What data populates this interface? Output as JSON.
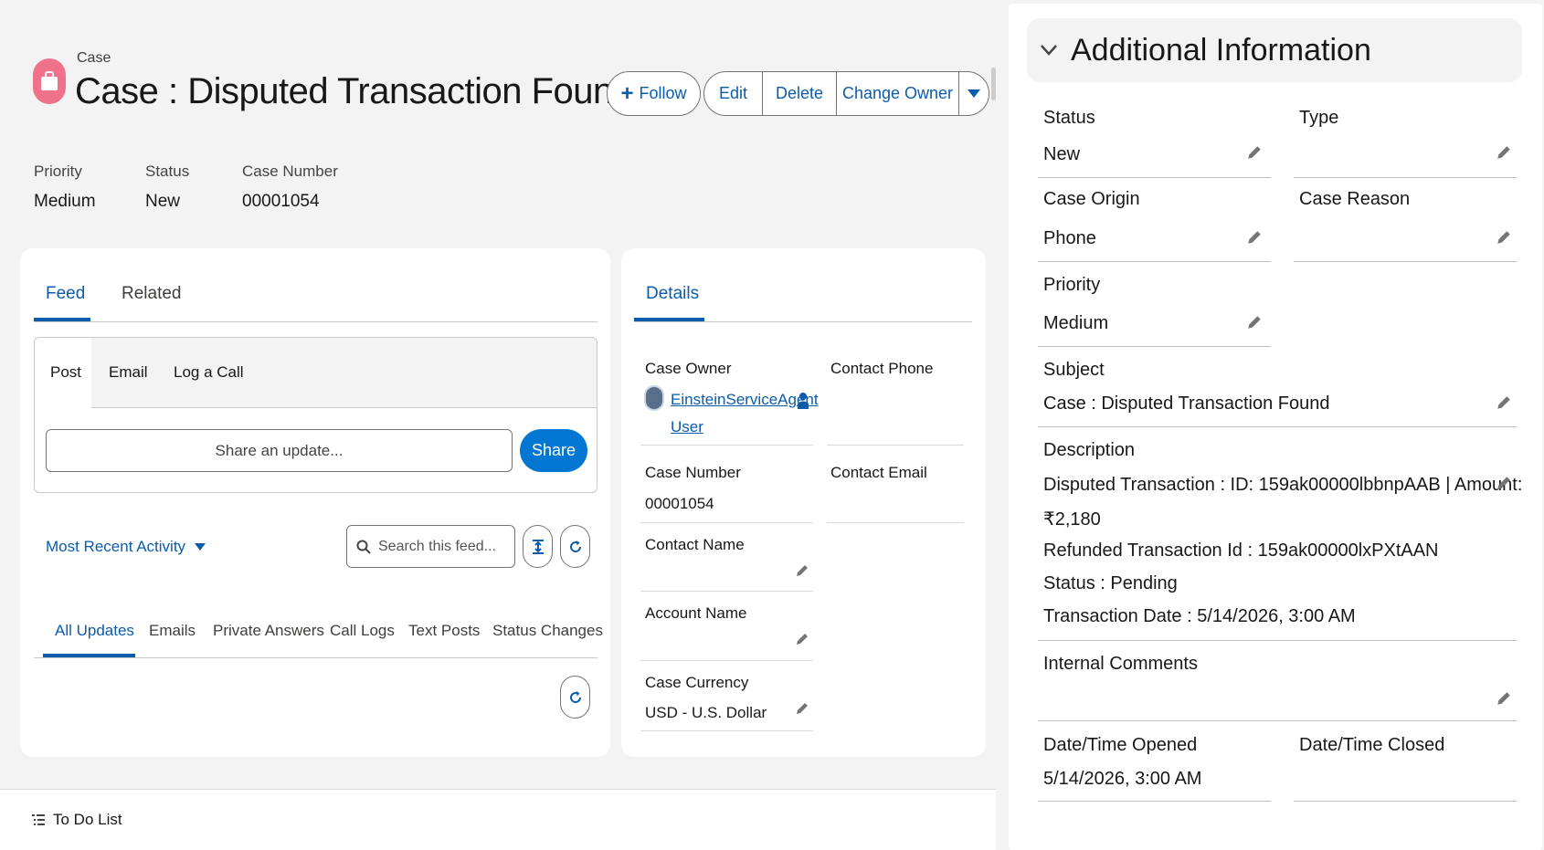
{
  "header": {
    "object_label": "Case",
    "title": "Case : Disputed Transaction Found",
    "buttons": {
      "follow": "Follow",
      "edit": "Edit",
      "delete": "Delete",
      "change_owner": "Change Owner"
    }
  },
  "highlights": [
    {
      "label": "Priority",
      "value": "Medium"
    },
    {
      "label": "Status",
      "value": "New"
    },
    {
      "label": "Case Number",
      "value": "00001054"
    }
  ],
  "feed_card": {
    "tabs": [
      "Feed",
      "Related"
    ],
    "publisher_tabs": [
      "Post",
      "Email",
      "Log a Call"
    ],
    "share_placeholder": "Share an update...",
    "share_button": "Share",
    "sort_label": "Most Recent Activity",
    "search_placeholder": "Search this feed...",
    "filters": [
      "All Updates",
      "Emails",
      "Private Answers",
      "Call Logs",
      "Text Posts",
      "Status Changes"
    ]
  },
  "details_card": {
    "tab": "Details",
    "case_owner_label": "Case Owner",
    "case_owner_line1": "EinsteinServiceAgent",
    "case_owner_line2": "User",
    "contact_phone_label": "Contact Phone",
    "case_number_label": "Case Number",
    "case_number_value": "00001054",
    "contact_email_label": "Contact Email",
    "contact_name_label": "Contact Name",
    "account_name_label": "Account Name",
    "case_currency_label": "Case Currency",
    "case_currency_value": "USD - U.S. Dollar"
  },
  "footer": {
    "todo_label": "To Do List"
  },
  "additional_info": {
    "section_title": "Additional Information",
    "status_label": "Status",
    "status_value": "New",
    "type_label": "Type",
    "case_origin_label": "Case Origin",
    "case_origin_value": "Phone",
    "case_reason_label": "Case Reason",
    "priority_label": "Priority",
    "priority_value": "Medium",
    "subject_label": "Subject",
    "subject_value": "Case : Disputed Transaction Found",
    "description_label": "Description",
    "description_lines": [
      "Disputed Transaction : ID: 159ak00000lbbnpAAB | Amount:",
      "₹2,180",
      "Refunded Transaction Id : 159ak00000lxPXtAAN",
      "Status : Pending",
      "Transaction Date : 5/14/2026, 3:00 AM"
    ],
    "internal_comments_label": "Internal Comments",
    "opened_label": "Date/Time Opened",
    "opened_value": "5/14/2026, 3:00 AM",
    "closed_label": "Date/Time Closed"
  },
  "colors": {
    "brand_blue": "#0b5cab",
    "button_blue": "#0176d3",
    "case_icon_pink": "#f0718a"
  }
}
